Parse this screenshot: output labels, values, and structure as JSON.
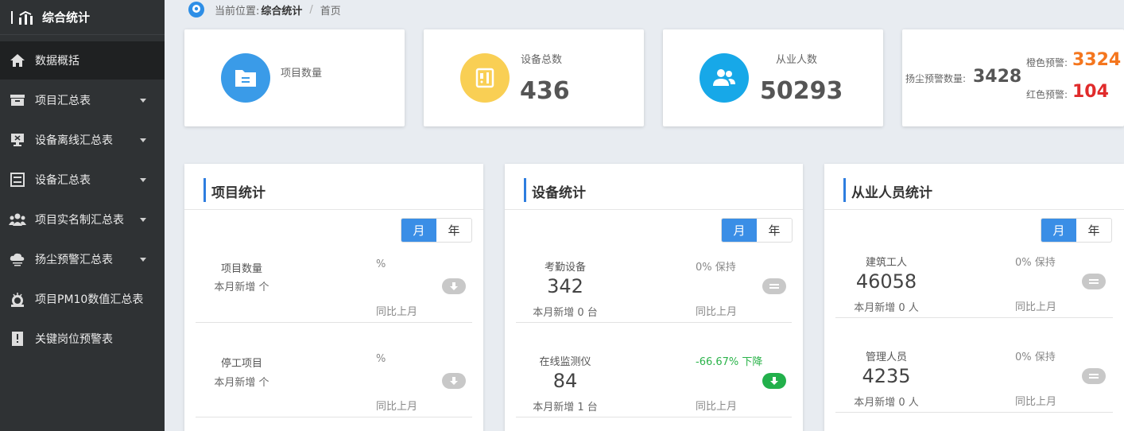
{
  "sidebar": {
    "brand": "综合统计",
    "items": [
      {
        "label": "数据概括",
        "icon": "home-icon",
        "active": true,
        "expandable": false
      },
      {
        "label": "项目汇总表",
        "icon": "folder-icon",
        "expandable": true
      },
      {
        "label": "设备离线汇总表",
        "icon": "monitor-icon",
        "expandable": true
      },
      {
        "label": "设备汇总表",
        "icon": "list-icon",
        "expandable": true
      },
      {
        "label": "项目实名制汇总表",
        "icon": "users-icon",
        "expandable": true
      },
      {
        "label": "扬尘预警汇总表",
        "icon": "cloud-icon",
        "expandable": true
      },
      {
        "label": "项目PM10数值汇总表",
        "icon": "pm-icon",
        "expandable": false
      },
      {
        "label": "关键岗位预警表",
        "icon": "alert-book-icon",
        "expandable": false
      }
    ]
  },
  "breadcrumb": {
    "prefix": "当前位置:",
    "current": "综合统计",
    "separator": "/",
    "page": "首页"
  },
  "stats": {
    "projects": {
      "label": "项目数量",
      "value": ""
    },
    "devices": {
      "label": "设备总数",
      "value": "436"
    },
    "workers": {
      "label": "从业人数",
      "value": "50293"
    },
    "dust": {
      "label": "扬尘预警数量:",
      "value": "3428",
      "orange_label": "橙色预警:",
      "orange_value": "3324",
      "red_label": "红色预警:",
      "red_value": "104"
    }
  },
  "panels": {
    "project": {
      "title": "项目统计",
      "toggle": {
        "month": "月",
        "year": "年",
        "selected": "月"
      },
      "rows": [
        {
          "name": "项目数量",
          "value": "",
          "sub": "本月新增 个",
          "pct": "%",
          "compare": "同比上月",
          "trend": "down",
          "trend_color": "#c8c8c8"
        },
        {
          "name": "停工项目",
          "value": "",
          "sub": "本月新增 个",
          "pct": "%",
          "compare": "同比上月",
          "trend": "down",
          "trend_color": "#c8c8c8"
        }
      ]
    },
    "device": {
      "title": "设备统计",
      "toggle": {
        "month": "月",
        "year": "年",
        "selected": "月"
      },
      "rows": [
        {
          "name": "考勤设备",
          "value": "342",
          "sub": "本月新增 0 台",
          "pct": "0% 保持",
          "compare": "同比上月",
          "trend": "flat",
          "trend_color": "#c8c8c8"
        },
        {
          "name": "在线监测仪",
          "value": "84",
          "sub": "本月新增 1 台",
          "pct": "-66.67% 下降",
          "compare": "同比上月",
          "trend": "down",
          "trend_color": "#22b04b"
        }
      ]
    },
    "staff": {
      "title": "从业人员统计",
      "toggle": {
        "month": "月",
        "year": "年",
        "selected": "月"
      },
      "rows": [
        {
          "name": "建筑工人",
          "value": "46058",
          "sub": "本月新增 0 人",
          "pct": "0% 保持",
          "compare": "同比上月",
          "trend": "flat",
          "trend_color": "#c8c8c8"
        },
        {
          "name": "管理人员",
          "value": "4235",
          "sub": "本月新增 0 人",
          "pct": "0% 保持",
          "compare": "同比上月",
          "trend": "flat",
          "trend_color": "#c8c8c8"
        }
      ]
    }
  },
  "colors": {
    "sidebar_bg": "#2f3234",
    "accent_blue": "#2d7ddf",
    "toggle_active": "#3a8ee6",
    "projects_circle": "#3a9be8",
    "devices_circle": "#f9cf54",
    "workers_circle": "#17a8e8",
    "orange_warning": "#f4761e",
    "red_warning": "#e02b2b",
    "trend_down_green": "#22b04b"
  }
}
